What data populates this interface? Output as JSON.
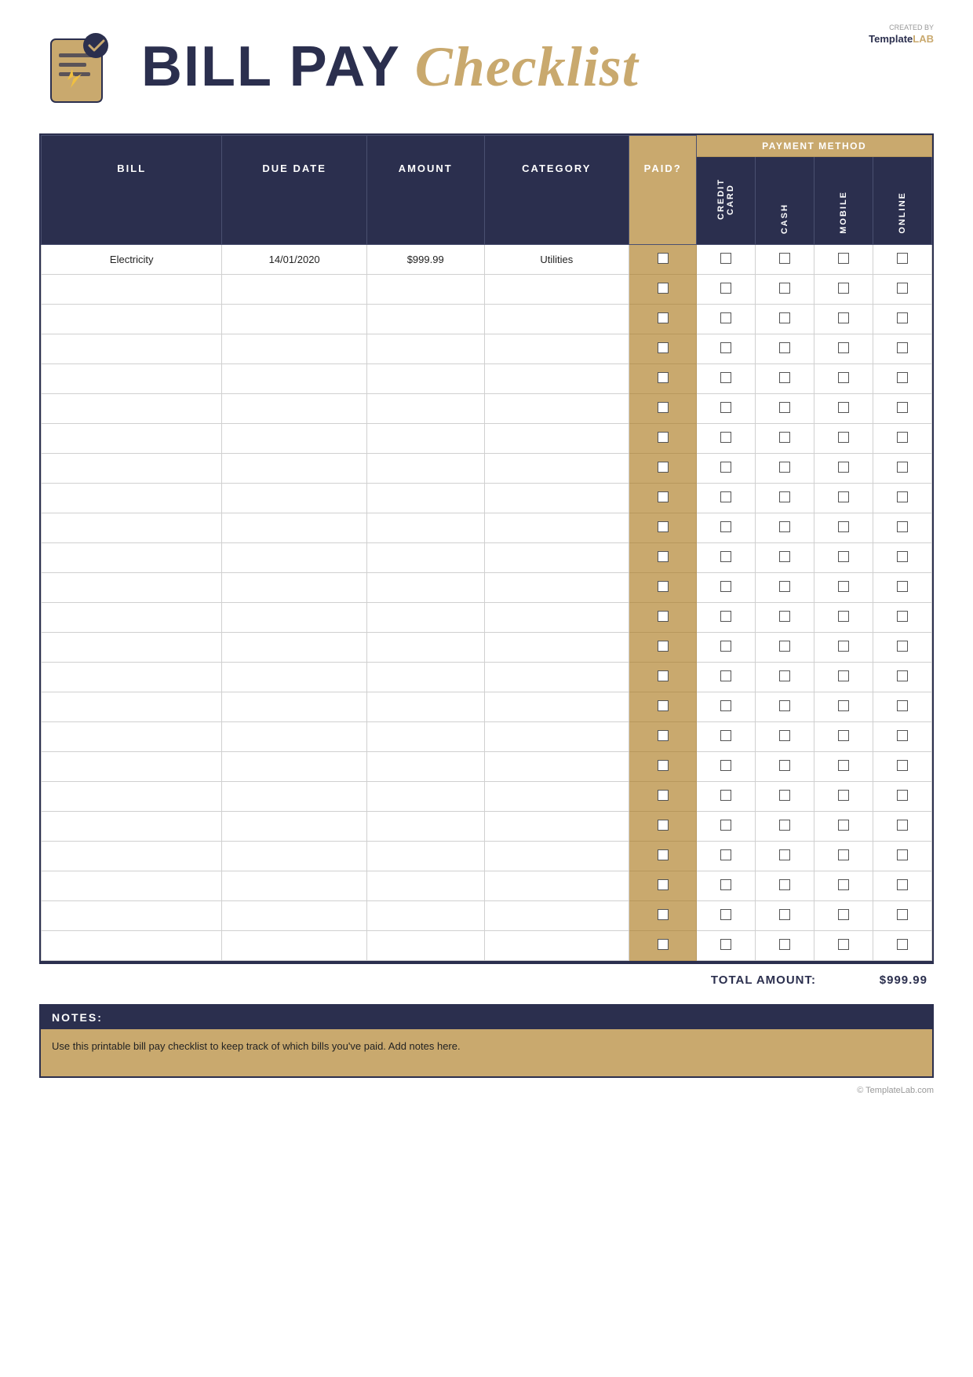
{
  "header": {
    "bill_pay": "BILL PAY",
    "checklist": "Checklist",
    "templatelab": "TemplateLAB",
    "created_by": "CREATED BY"
  },
  "table": {
    "columns": {
      "bill": "BILL",
      "due_date": "DUE DATE",
      "amount": "AMOUNT",
      "category": "CATEGORY",
      "paid": "PAID?",
      "payment_method": "PAYMENT METHOD",
      "credit_card": "CREDIT CARD",
      "cash": "CASH",
      "mobile": "MOBILE",
      "online": "ONLINE"
    },
    "rows": [
      {
        "bill": "Electricity",
        "due_date": "14/01/2020",
        "amount": "$999.99",
        "category": "Utilities"
      },
      {
        "bill": "",
        "due_date": "",
        "amount": "",
        "category": ""
      },
      {
        "bill": "",
        "due_date": "",
        "amount": "",
        "category": ""
      },
      {
        "bill": "",
        "due_date": "",
        "amount": "",
        "category": ""
      },
      {
        "bill": "",
        "due_date": "",
        "amount": "",
        "category": ""
      },
      {
        "bill": "",
        "due_date": "",
        "amount": "",
        "category": ""
      },
      {
        "bill": "",
        "due_date": "",
        "amount": "",
        "category": ""
      },
      {
        "bill": "",
        "due_date": "",
        "amount": "",
        "category": ""
      },
      {
        "bill": "",
        "due_date": "",
        "amount": "",
        "category": ""
      },
      {
        "bill": "",
        "due_date": "",
        "amount": "",
        "category": ""
      },
      {
        "bill": "",
        "due_date": "",
        "amount": "",
        "category": ""
      },
      {
        "bill": "",
        "due_date": "",
        "amount": "",
        "category": ""
      },
      {
        "bill": "",
        "due_date": "",
        "amount": "",
        "category": ""
      },
      {
        "bill": "",
        "due_date": "",
        "amount": "",
        "category": ""
      },
      {
        "bill": "",
        "due_date": "",
        "amount": "",
        "category": ""
      },
      {
        "bill": "",
        "due_date": "",
        "amount": "",
        "category": ""
      },
      {
        "bill": "",
        "due_date": "",
        "amount": "",
        "category": ""
      },
      {
        "bill": "",
        "due_date": "",
        "amount": "",
        "category": ""
      },
      {
        "bill": "",
        "due_date": "",
        "amount": "",
        "category": ""
      },
      {
        "bill": "",
        "due_date": "",
        "amount": "",
        "category": ""
      },
      {
        "bill": "",
        "due_date": "",
        "amount": "",
        "category": ""
      },
      {
        "bill": "",
        "due_date": "",
        "amount": "",
        "category": ""
      },
      {
        "bill": "",
        "due_date": "",
        "amount": "",
        "category": ""
      },
      {
        "bill": "",
        "due_date": "",
        "amount": "",
        "category": ""
      }
    ]
  },
  "total": {
    "label": "TOTAL AMOUNT:",
    "value": "$999.99"
  },
  "notes": {
    "header": "NOTES:",
    "body": "Use this printable bill pay checklist to keep track of which bills you've paid. Add notes here."
  },
  "footer": {
    "text": "© TemplateLab.com"
  }
}
